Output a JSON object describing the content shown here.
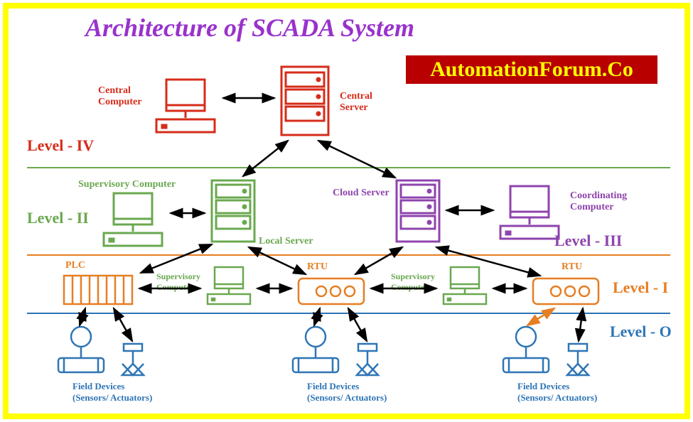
{
  "title": "Architecture of SCADA System",
  "banner": "AutomationForum.Co",
  "labels": {
    "central_computer": "Central\nComputer",
    "central_server": "Central\nServer",
    "supervisory_computer_l2": "Supervisory Computer",
    "local_server": "Local Server",
    "cloud_server": "Cloud Server",
    "coordinating_computer": "Coordinating\nComputer",
    "plc": "PLC",
    "supervisory_computer_1": "Supervisory\nComputer",
    "rtu_1": "RTU",
    "supervisory_computer_2": "Supervisory\nComputer",
    "rtu_2": "RTU",
    "field_devices_1": "Field Devices\n(Sensors/ Actuators)",
    "field_devices_2": "Field Devices\n(Sensors/ Actuators)",
    "field_devices_3": "Field Devices\n(Sensors/ Actuators)"
  },
  "levels": {
    "l4": "Level - IV",
    "l3": "Level - III",
    "l2": "Level - II",
    "l1": "Level - I",
    "l0": "Level - O"
  },
  "colors": {
    "red": "#d62c1a",
    "green": "#6aa84f",
    "purple": "#8e44ad",
    "orange": "#e67e22",
    "blue": "#2e75b6",
    "black": "#000000"
  }
}
